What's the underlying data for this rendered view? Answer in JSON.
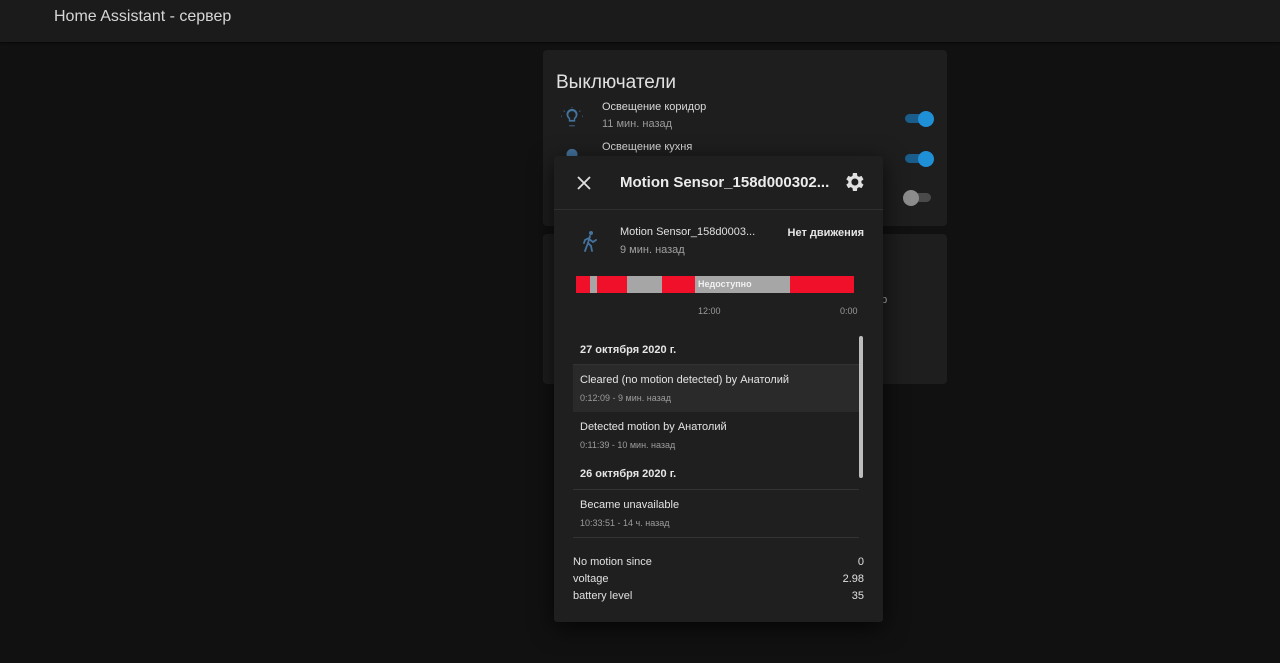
{
  "app": {
    "title": "Home Assistant - сервер"
  },
  "switches_card": {
    "title": "Выключатели",
    "items": [
      {
        "name": "Освещение коридор",
        "sub": "11 мин. назад",
        "state": "on",
        "icon": "lightbulb-icon"
      },
      {
        "name": "Освещение кухня",
        "sub": "",
        "state": "on",
        "icon": "lightbulb-icon"
      },
      {
        "name": "",
        "sub": "",
        "state": "off",
        "icon": ""
      }
    ]
  },
  "second_card": {
    "partial_text": "ор"
  },
  "dialog": {
    "title": "Motion Sensor_158d000302...",
    "close_icon": "close-icon",
    "settings_icon": "gear-icon",
    "entity": {
      "name": "Motion Sensor_158d0003...",
      "time": "9 мин. назад",
      "state": "Нет движения",
      "icon": "walk-icon"
    },
    "timeline": {
      "colors": {
        "detected": "#f0102a",
        "unavailable": "#a6a6a6"
      },
      "label": "Недоступно",
      "axis": [
        "12:00",
        "0:00"
      ]
    },
    "logbook": {
      "groups": [
        {
          "date": "27 октября 2020 г.",
          "entries": [
            {
              "message": "Cleared (no motion detected) by Анатолий",
              "time": "0:12:09 - 9 мин. назад"
            },
            {
              "message": "Detected motion by Анатолий",
              "time": "0:11:39 - 10 мин. назад"
            }
          ]
        },
        {
          "date": "26 октября 2020 г.",
          "entries": [
            {
              "message": "Became unavailable",
              "time": "10:33:51 - 14 ч. назад"
            }
          ]
        }
      ]
    },
    "attributes": [
      {
        "name": "No motion since",
        "value": "0"
      },
      {
        "name": "voltage",
        "value": "2.98"
      },
      {
        "name": "battery level",
        "value": "35"
      }
    ]
  }
}
